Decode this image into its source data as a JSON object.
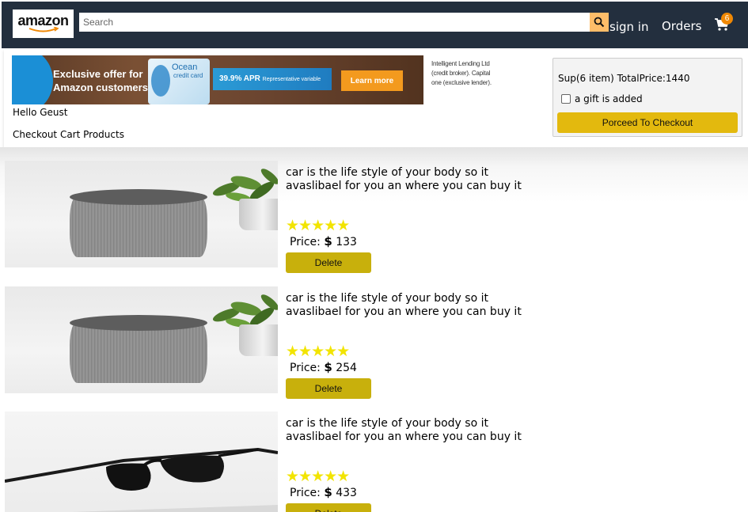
{
  "navbar": {
    "logo_text": "amazon",
    "search_placeholder": "Search",
    "signin_label": "sign in",
    "orders_label": "Orders",
    "cart_count": "6",
    "colors": {
      "background": "#232f3e",
      "search_button": "#febd69",
      "badge": "#f08804"
    }
  },
  "banner": {
    "headline": "Exclusive offer for Amazon customers",
    "card_name": "Ocean",
    "card_sub": "credit card",
    "apr_main": "39.9% APR",
    "apr_sub": "Representative variable",
    "learn_more": "Learn more",
    "disclaimer": "Intelligent Lending Ltd (credit broker). Capital one (exclusive lender)."
  },
  "greeting": "Hello Geust",
  "section_title": "Checkout Cart Products",
  "subtotal": {
    "summary": "Sup(6 item) TotalPrice:1440",
    "gift_label": "a gift is added",
    "checkout_label": "Porceed To Checkout"
  },
  "products": [
    {
      "image": "speaker",
      "description": "car is the life style of your body so it avaslibael for you an where you can buy it",
      "rating": 5,
      "stars": "★★★★★",
      "price_label": "Price:",
      "currency": "$",
      "price": "133",
      "delete_label": "Delete"
    },
    {
      "image": "speaker",
      "description": "car is the life style of your body so it avaslibael for you an where you can buy it",
      "rating": 5,
      "stars": "★★★★★",
      "price_label": "Price:",
      "currency": "$",
      "price": "254",
      "delete_label": "Delete"
    },
    {
      "image": "sunglasses",
      "description": "car is the life style of your body so it avaslibael for you an where you can buy it",
      "rating": 5,
      "stars": "★★★★★",
      "price_label": "Price:",
      "currency": "$",
      "price": "433",
      "delete_label": "Delete"
    }
  ]
}
